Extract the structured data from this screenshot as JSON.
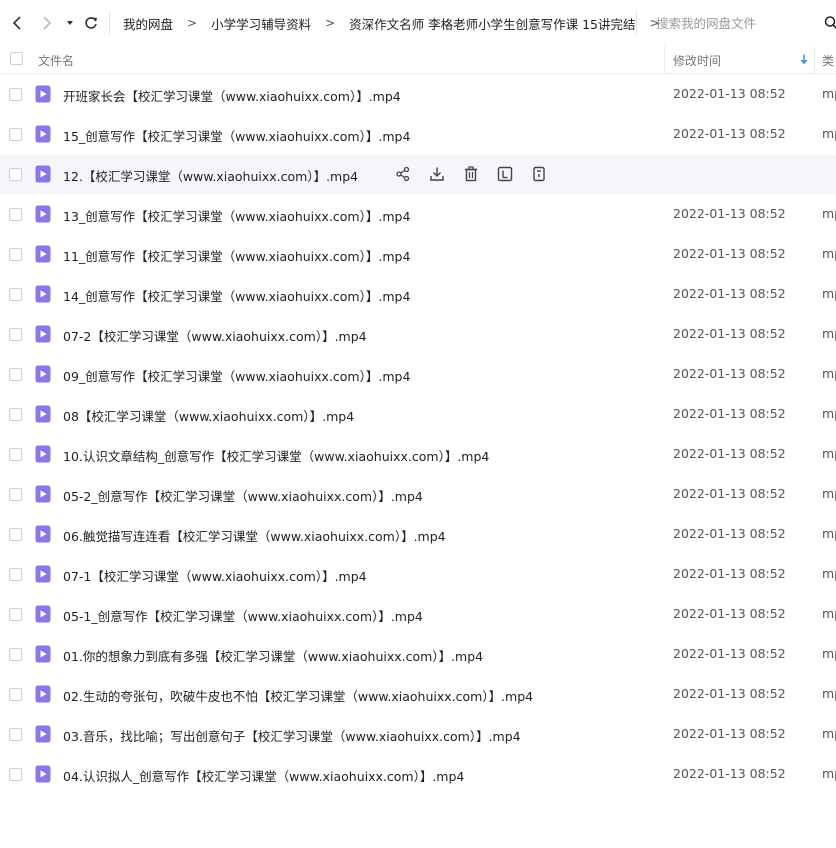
{
  "breadcrumb": [
    "我的网盘",
    "小学学习辅导资料",
    "资深作文名师 李格老师小学生创意写作课 15讲完结"
  ],
  "search": {
    "placeholder": "搜索我的网盘文件"
  },
  "columns": {
    "name": "文件名",
    "modified": "修改时间",
    "type_partial": "类"
  },
  "colors": {
    "file_icon": "#8a76e8",
    "accent": "#4a90e2",
    "row_hover": "#f5f6fa"
  },
  "icons": {
    "nav": [
      "chevron-left-icon",
      "chevron-right-icon",
      "caret-down-icon",
      "refresh-icon",
      "search-icon"
    ],
    "row_actions": [
      "share-icon",
      "download-icon",
      "delete-icon",
      "rename-icon",
      "more-icon"
    ],
    "file": "video-file-icon"
  },
  "files": [
    {
      "name": "开班家长会【校汇学习课堂（www.xiaohuixx.com）】.mp4",
      "modified": "2022-01-13 08:52",
      "type": "mp"
    },
    {
      "name": "15_创意写作【校汇学习课堂（www.xiaohuixx.com）】.mp4",
      "modified": "2022-01-13 08:52",
      "type": "mp"
    },
    {
      "name": "12.【校汇学习课堂（www.xiaohuixx.com）】.mp4",
      "modified": "",
      "type": ""
    },
    {
      "name": "13_创意写作【校汇学习课堂（www.xiaohuixx.com）】.mp4",
      "modified": "2022-01-13 08:52",
      "type": "mp"
    },
    {
      "name": "11_创意写作【校汇学习课堂（www.xiaohuixx.com）】.mp4",
      "modified": "2022-01-13 08:52",
      "type": "mp"
    },
    {
      "name": "14_创意写作【校汇学习课堂（www.xiaohuixx.com）】.mp4",
      "modified": "2022-01-13 08:52",
      "type": "mp"
    },
    {
      "name": "07-2【校汇学习课堂（www.xiaohuixx.com）】.mp4",
      "modified": "2022-01-13 08:52",
      "type": "mp"
    },
    {
      "name": "09_创意写作【校汇学习课堂（www.xiaohuixx.com）】.mp4",
      "modified": "2022-01-13 08:52",
      "type": "mp"
    },
    {
      "name": "08【校汇学习课堂（www.xiaohuixx.com）】.mp4",
      "modified": "2022-01-13 08:52",
      "type": "mp"
    },
    {
      "name": "10.认识文章结构_创意写作【校汇学习课堂（www.xiaohuixx.com）】.mp4",
      "modified": "2022-01-13 08:52",
      "type": "mp"
    },
    {
      "name": "05-2_创意写作【校汇学习课堂（www.xiaohuixx.com）】.mp4",
      "modified": "2022-01-13 08:52",
      "type": "mp"
    },
    {
      "name": "06.触觉描写连连看【校汇学习课堂（www.xiaohuixx.com）】.mp4",
      "modified": "2022-01-13 08:52",
      "type": "mp"
    },
    {
      "name": "07-1【校汇学习课堂（www.xiaohuixx.com）】.mp4",
      "modified": "2022-01-13 08:52",
      "type": "mp"
    },
    {
      "name": "05-1_创意写作【校汇学习课堂（www.xiaohuixx.com）】.mp4",
      "modified": "2022-01-13 08:52",
      "type": "mp"
    },
    {
      "name": "01.你的想象力到底有多强【校汇学习课堂（www.xiaohuixx.com）】.mp4",
      "modified": "2022-01-13 08:52",
      "type": "mp"
    },
    {
      "name": "02.生动的夸张句，吹破牛皮也不怕【校汇学习课堂（www.xiaohuixx.com）】.mp4",
      "modified": "2022-01-13 08:52",
      "type": "mp"
    },
    {
      "name": "03.音乐，找比喻；写出创意句子【校汇学习课堂（www.xiaohuixx.com）】.mp4",
      "modified": "2022-01-13 08:52",
      "type": "mp"
    },
    {
      "name": "04.认识拟人_创意写作【校汇学习课堂（www.xiaohuixx.com）】.mp4",
      "modified": "2022-01-13 08:52",
      "type": "mp"
    }
  ]
}
